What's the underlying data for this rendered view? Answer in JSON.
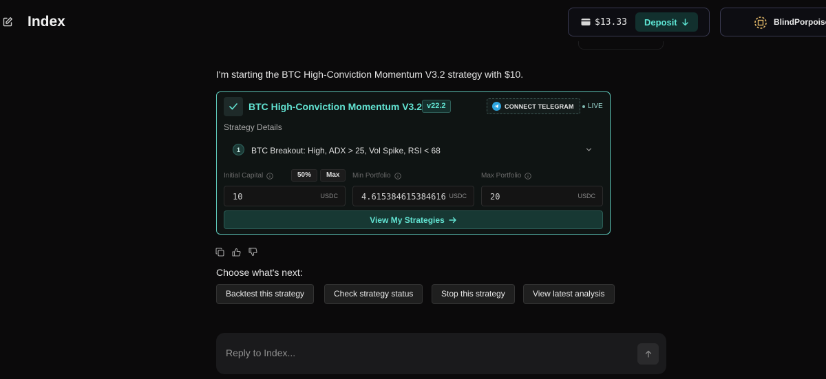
{
  "header": {
    "title": "Index",
    "wallet_balance": "$13.33",
    "deposit_label": "Deposit",
    "user_name": "BlindPorpoise"
  },
  "message": {
    "text": "I'm starting the BTC High-Conviction Momentum V3.2 strategy with $10."
  },
  "strategy_card": {
    "name": "BTC High-Conviction Momentum V3.2",
    "version": "v22.2",
    "connect_telegram_label": "CONNECT TELEGRAM",
    "status": "LIVE",
    "details_label": "Strategy Details",
    "rules": [
      {
        "number": "1",
        "text": "BTC Breakout: High, ADX > 25, Vol Spike, RSI < 68"
      }
    ],
    "fields": {
      "initial_capital": {
        "label": "Initial Capital",
        "value": "10",
        "unit": "USDC",
        "chips": [
          "50%",
          "Max"
        ]
      },
      "min_portfolio": {
        "label": "Min Portfolio",
        "value": "4.615384615384616",
        "unit": "USDC"
      },
      "max_portfolio": {
        "label": "Max Portfolio",
        "value": "20",
        "unit": "USDC"
      }
    },
    "view_button_label": "View My Strategies"
  },
  "next": {
    "label": "Choose what's next:",
    "options": [
      "Backtest this strategy",
      "Check strategy status",
      "Stop this strategy",
      "View latest analysis"
    ]
  },
  "reply": {
    "placeholder": "Reply to Index..."
  },
  "colors": {
    "accent": "#62e3d2",
    "background": "#0b0a0b",
    "card_border": "#5ec9bb"
  }
}
